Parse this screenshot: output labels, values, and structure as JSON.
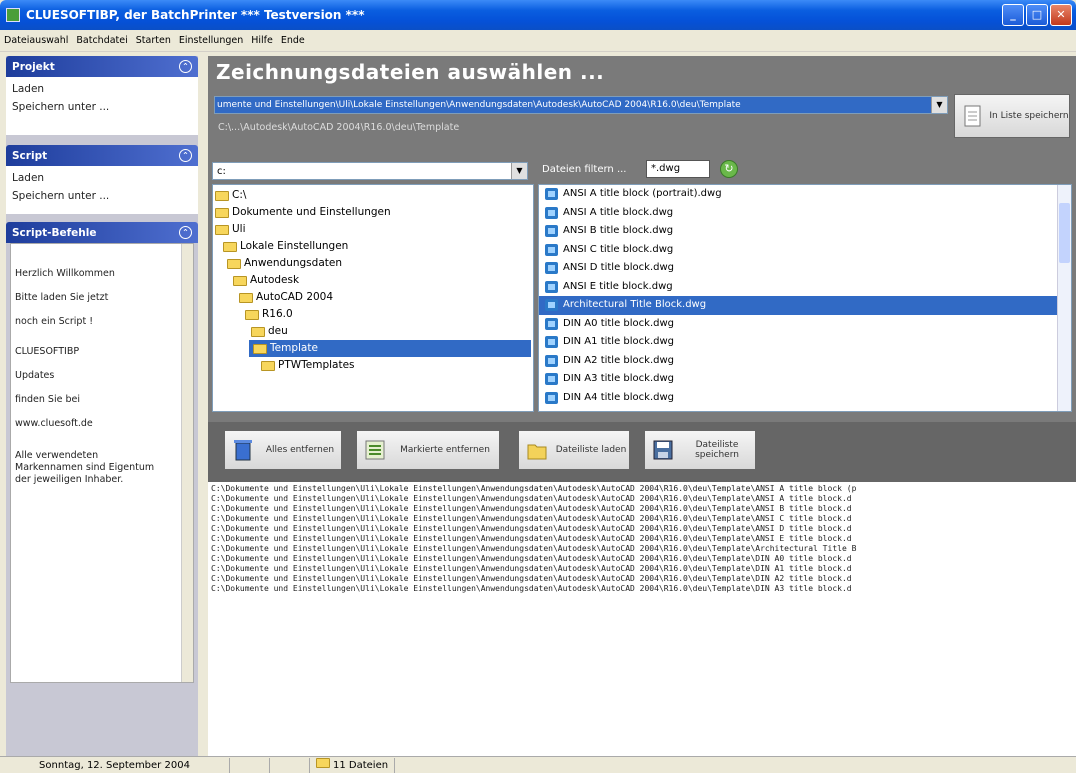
{
  "window": {
    "title": "CLUESOFTIBP, der BatchPrinter *** Testversion ***"
  },
  "menu": [
    "Dateiauswahl",
    "Batchdatei",
    "Starten",
    "Einstellungen",
    "Hilfe",
    "Ende"
  ],
  "sidebar": {
    "projekt": {
      "title": "Projekt",
      "items": [
        "Laden",
        "Speichern unter ..."
      ]
    },
    "script": {
      "title": "Script",
      "items": [
        "Laden",
        "Speichern unter ..."
      ]
    },
    "befehle": {
      "title": "Script-Befehle",
      "lines": [
        "Herzlich Willkommen",
        "Bitte laden Sie jetzt",
        "noch ein Script !",
        "CLUESOFTIBP",
        "Updates",
        "finden Sie bei",
        "www.cluesoft.de",
        "Alle verwendeten Markennamen sind Eigentum der jeweiligen Inhaber."
      ]
    }
  },
  "main": {
    "heading": "Zeichnungsdateien auswählen ...",
    "path_value": "umente und Einstellungen\\Uli\\Lokale Einstellungen\\Anwendungsdaten\\Autodesk\\AutoCAD 2004\\R16.0\\deu\\Template",
    "short_path": "C:\\...\\Autodesk\\AutoCAD 2004\\R16.0\\deu\\Template",
    "save_list_btn": "In Liste speichern",
    "drive": "c:",
    "filter_label": "Dateien filtern ...",
    "filter_value": "*.dwg",
    "tree": [
      "C:\\",
      "Dokumente und Einstellungen",
      "Uli",
      "Lokale Einstellungen",
      "Anwendungsdaten",
      "Autodesk",
      "AutoCAD 2004",
      "R16.0",
      "deu",
      "Template",
      "PTWTemplates"
    ],
    "files": [
      "ANSI A title block (portrait).dwg",
      "ANSI A title block.dwg",
      "ANSI B title block.dwg",
      "ANSI C title block.dwg",
      "ANSI D title block.dwg",
      "ANSI E title block.dwg",
      "Architectural Title Block.dwg",
      "DIN A0 title block.dwg",
      "DIN A1 title block.dwg",
      "DIN A2 title block.dwg",
      "DIN A3 title block.dwg",
      "DIN A4 title block.dwg"
    ],
    "selected_file": "Architectural Title Block.dwg",
    "buttons": {
      "alle": "Alles entfernen",
      "markierte": "Markierte entfernen",
      "laden": "Dateiliste laden",
      "speichern": "Dateiliste speichern"
    },
    "output": [
      "C:\\Dokumente und Einstellungen\\Uli\\Lokale Einstellungen\\Anwendungsdaten\\Autodesk\\AutoCAD 2004\\R16.0\\deu\\Template\\ANSI A title block (p",
      "C:\\Dokumente und Einstellungen\\Uli\\Lokale Einstellungen\\Anwendungsdaten\\Autodesk\\AutoCAD 2004\\R16.0\\deu\\Template\\ANSI A title block.d",
      "C:\\Dokumente und Einstellungen\\Uli\\Lokale Einstellungen\\Anwendungsdaten\\Autodesk\\AutoCAD 2004\\R16.0\\deu\\Template\\ANSI B title block.d",
      "C:\\Dokumente und Einstellungen\\Uli\\Lokale Einstellungen\\Anwendungsdaten\\Autodesk\\AutoCAD 2004\\R16.0\\deu\\Template\\ANSI C title block.d",
      "C:\\Dokumente und Einstellungen\\Uli\\Lokale Einstellungen\\Anwendungsdaten\\Autodesk\\AutoCAD 2004\\R16.0\\deu\\Template\\ANSI D title block.d",
      "C:\\Dokumente und Einstellungen\\Uli\\Lokale Einstellungen\\Anwendungsdaten\\Autodesk\\AutoCAD 2004\\R16.0\\deu\\Template\\ANSI E title block.d",
      "C:\\Dokumente und Einstellungen\\Uli\\Lokale Einstellungen\\Anwendungsdaten\\Autodesk\\AutoCAD 2004\\R16.0\\deu\\Template\\Architectural Title B",
      "C:\\Dokumente und Einstellungen\\Uli\\Lokale Einstellungen\\Anwendungsdaten\\Autodesk\\AutoCAD 2004\\R16.0\\deu\\Template\\DIN A0 title block.d",
      "C:\\Dokumente und Einstellungen\\Uli\\Lokale Einstellungen\\Anwendungsdaten\\Autodesk\\AutoCAD 2004\\R16.0\\deu\\Template\\DIN A1 title block.d",
      "C:\\Dokumente und Einstellungen\\Uli\\Lokale Einstellungen\\Anwendungsdaten\\Autodesk\\AutoCAD 2004\\R16.0\\deu\\Template\\DIN A2 title block.d",
      "C:\\Dokumente und Einstellungen\\Uli\\Lokale Einstellungen\\Anwendungsdaten\\Autodesk\\AutoCAD 2004\\R16.0\\deu\\Template\\DIN A3 title block.d"
    ]
  },
  "status": {
    "date": "Sonntag, 12. September 2004",
    "count": "11 Dateien"
  }
}
